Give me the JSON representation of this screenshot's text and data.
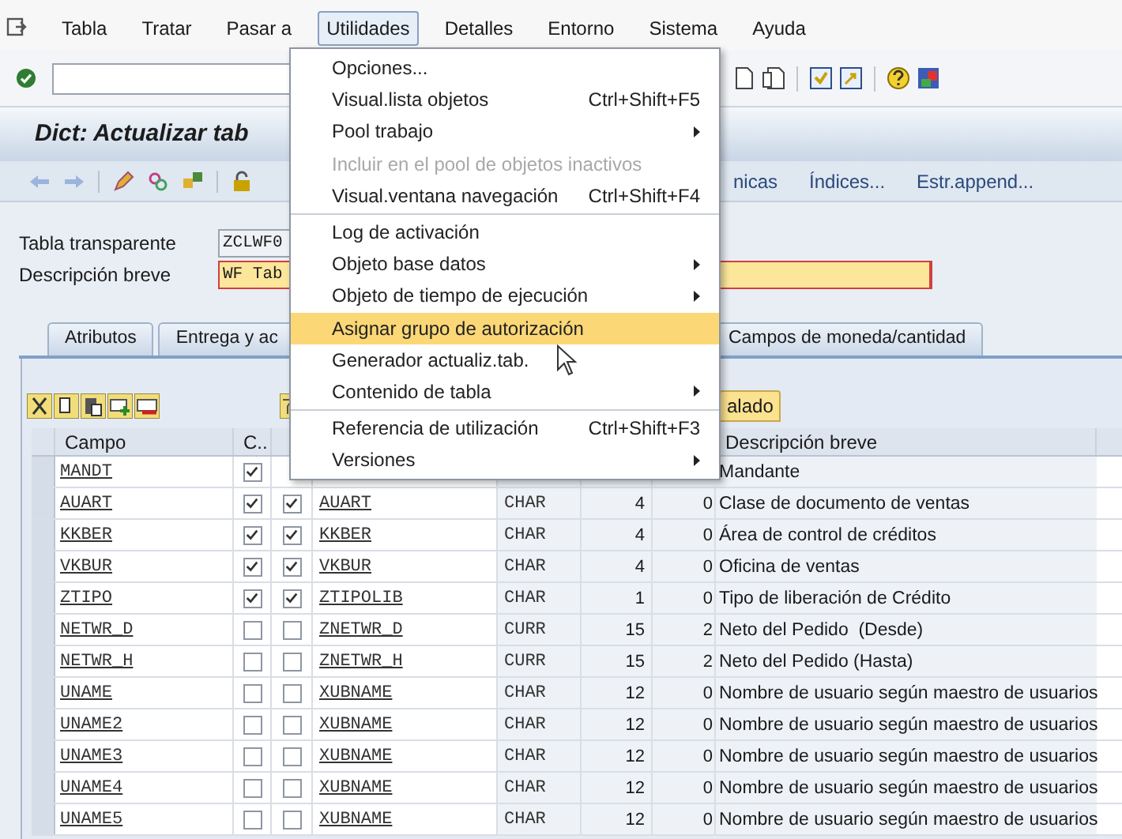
{
  "menu_bar": [
    {
      "label": "Tabla",
      "selected": false
    },
    {
      "label": "Tratar",
      "selected": false
    },
    {
      "label": "Pasar a",
      "selected": false
    },
    {
      "label": "Utilidades",
      "selected": true
    },
    {
      "label": "Detalles",
      "selected": false
    },
    {
      "label": "Entorno",
      "selected": false
    },
    {
      "label": "Sistema",
      "selected": false
    },
    {
      "label": "Ayuda",
      "selected": false
    }
  ],
  "title": "Dict: Actualizar tab",
  "app_toolbar": [
    "nicas",
    "Índices...",
    "Estr.append..."
  ],
  "fields": [
    {
      "label": "Tabla transparente",
      "value": "ZCLWF0",
      "required": false
    },
    {
      "label": "Descripción breve",
      "value": "WF Tab",
      "required": true
    }
  ],
  "tabs": [
    {
      "label": "Atributos",
      "selected": false
    },
    {
      "label": "Entrega y ac",
      "selected": false
    },
    {
      "label": "Campos de moneda/cantidad",
      "selected": false
    }
  ],
  "table_toolbar": {
    "button": "alado"
  },
  "table": {
    "columns": {
      "field": "Campo",
      "key": "C..",
      "description": "Descripción breve"
    },
    "rows": [
      {
        "field": "MANDT",
        "key": true,
        "description": "Mandante"
      },
      {
        "field": "AUART",
        "key": true,
        "initial": true,
        "element": "AUART",
        "type": "CHAR",
        "length": "4",
        "decimals": "0",
        "description": "Clase de documento de ventas"
      },
      {
        "field": "KKBER",
        "key": true,
        "initial": true,
        "element": "KKBER",
        "type": "CHAR",
        "length": "4",
        "decimals": "0",
        "description": "Área de control de créditos"
      },
      {
        "field": "VKBUR",
        "key": true,
        "initial": true,
        "element": "VKBUR",
        "type": "CHAR",
        "length": "4",
        "decimals": "0",
        "description": "Oficina de ventas"
      },
      {
        "field": "ZTIPO",
        "key": true,
        "initial": true,
        "element": "ZTIPOLIB",
        "type": "CHAR",
        "length": "1",
        "decimals": "0",
        "description": "Tipo de liberación de Crédito"
      },
      {
        "field": "NETWR_D",
        "key": false,
        "initial": false,
        "element": "ZNETWR_D",
        "type": "CURR",
        "length": "15",
        "decimals": "2",
        "description": "Neto del Pedido  (Desde)"
      },
      {
        "field": "NETWR_H",
        "key": false,
        "initial": false,
        "element": "ZNETWR_H",
        "type": "CURR",
        "length": "15",
        "decimals": "2",
        "description": "Neto del Pedido (Hasta)"
      },
      {
        "field": "UNAME",
        "key": false,
        "initial": false,
        "element": "XUBNAME",
        "type": "CHAR",
        "length": "12",
        "decimals": "0",
        "description": "Nombre de usuario según maestro de usuarios"
      },
      {
        "field": "UNAME2",
        "key": false,
        "initial": false,
        "element": "XUBNAME",
        "type": "CHAR",
        "length": "12",
        "decimals": "0",
        "description": "Nombre de usuario según maestro de usuarios"
      },
      {
        "field": "UNAME3",
        "key": false,
        "initial": false,
        "element": "XUBNAME",
        "type": "CHAR",
        "length": "12",
        "decimals": "0",
        "description": "Nombre de usuario según maestro de usuarios"
      },
      {
        "field": "UNAME4",
        "key": false,
        "initial": false,
        "element": "XUBNAME",
        "type": "CHAR",
        "length": "12",
        "decimals": "0",
        "description": "Nombre de usuario según maestro de usuarios"
      },
      {
        "field": "UNAME5",
        "key": false,
        "initial": false,
        "element": "XUBNAME",
        "type": "CHAR",
        "length": "12",
        "decimals": "0",
        "description": "Nombre de usuario según maestro de usuarios"
      }
    ]
  },
  "menu": {
    "items": [
      {
        "kind": "item",
        "label": "Opciones...",
        "disabled": false,
        "submenu": false,
        "selected": false
      },
      {
        "kind": "item",
        "label": "Visual.lista objetos",
        "shortcut": "Ctrl+Shift+F5",
        "disabled": false,
        "submenu": false,
        "selected": false
      },
      {
        "kind": "item",
        "label": "Pool trabajo",
        "disabled": false,
        "submenu": true,
        "selected": false
      },
      {
        "kind": "item",
        "label": "Incluir en el pool de objetos inactivos",
        "disabled": true,
        "submenu": false,
        "selected": false
      },
      {
        "kind": "item",
        "label": "Visual.ventana navegación",
        "shortcut": "Ctrl+Shift+F4",
        "disabled": false,
        "submenu": false,
        "selected": false
      },
      {
        "kind": "separator"
      },
      {
        "kind": "item",
        "label": "Log de activación",
        "disabled": false,
        "submenu": false,
        "selected": false
      },
      {
        "kind": "item",
        "label": "Objeto base datos",
        "disabled": false,
        "submenu": true,
        "selected": false
      },
      {
        "kind": "item",
        "label": "Objeto de tiempo de ejecución",
        "disabled": false,
        "submenu": true,
        "selected": false
      },
      {
        "kind": "item",
        "label": "Asignar grupo de autorización",
        "disabled": false,
        "submenu": false,
        "selected": true
      },
      {
        "kind": "item",
        "label": "Generador actualiz.tab.",
        "disabled": false,
        "submenu": false,
        "selected": false
      },
      {
        "kind": "item",
        "label": "Contenido de tabla",
        "disabled": false,
        "submenu": true,
        "selected": false
      },
      {
        "kind": "separator"
      },
      {
        "kind": "item",
        "label": "Referencia de utilización",
        "shortcut": "Ctrl+Shift+F3",
        "disabled": false,
        "submenu": false,
        "selected": false
      },
      {
        "kind": "item",
        "label": "Versiones",
        "disabled": false,
        "submenu": true,
        "selected": false
      }
    ]
  }
}
